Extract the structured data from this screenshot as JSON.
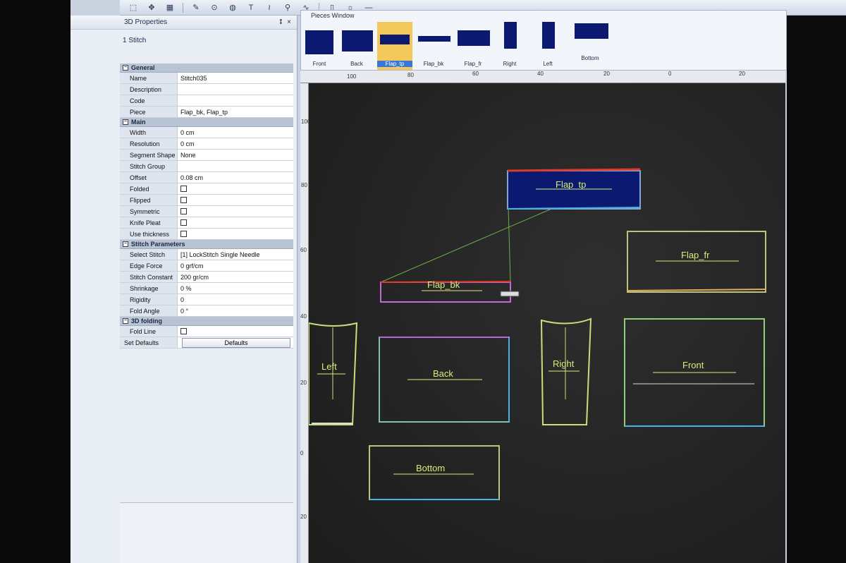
{
  "toolbar": {
    "icons": [
      "select-icon",
      "move-icon",
      "grid-icon",
      "pen-icon",
      "point-icon",
      "globe-icon",
      "text-icon",
      "stitch-icon",
      "needle-icon",
      "curve-icon"
    ],
    "text_glyph": "T"
  },
  "properties_panel": {
    "title": "3D Properties",
    "pin_glyph": "⭥",
    "close_glyph": "×",
    "selection": "1 Stitch",
    "categories": [
      {
        "name": "General",
        "rows": [
          {
            "key": "Name",
            "value": "Stitch035"
          },
          {
            "key": "Description",
            "value": ""
          },
          {
            "key": "Code",
            "value": ""
          },
          {
            "key": "Piece",
            "value": "Flap_bk, Flap_tp"
          }
        ]
      },
      {
        "name": "Main",
        "rows": [
          {
            "key": "Width",
            "value": "0 cm"
          },
          {
            "key": "Resolution",
            "value": "0 cm"
          },
          {
            "key": "Segment Shape",
            "value": "None"
          },
          {
            "key": "Stitch Group",
            "value": ""
          },
          {
            "key": "Offset",
            "value": "0.08 cm"
          },
          {
            "key": "Folded",
            "checkbox": true
          },
          {
            "key": "Flipped",
            "checkbox": true
          },
          {
            "key": "Symmetric",
            "checkbox": true
          },
          {
            "key": "Knife Pleat",
            "checkbox": true
          },
          {
            "key": "Use thickness",
            "checkbox": true
          }
        ]
      },
      {
        "name": "Stitch Parameters",
        "rows": [
          {
            "key": "Select Stitch",
            "value": "[1] LockStitch Single Needle"
          },
          {
            "key": "Edge Force",
            "value": "0 grf/cm"
          },
          {
            "key": "Stitch Constant",
            "value": "200 gr/cm"
          },
          {
            "key": "Shrinkage",
            "value": "0 %"
          },
          {
            "key": "Rigidity",
            "value": "0"
          },
          {
            "key": "Fold Angle",
            "value": "0 °"
          }
        ]
      },
      {
        "name": "3D folding",
        "rows": [
          {
            "key": "Fold Line",
            "checkbox": true
          }
        ]
      }
    ],
    "set_defaults_label": "Set Defaults",
    "defaults_button": "Defaults"
  },
  "pieces_window": {
    "title": "Pieces Window",
    "pieces": [
      "Front",
      "Back",
      "Flap_tp",
      "Flap_bk",
      "Flap_fr",
      "Right",
      "Left",
      "Bottom"
    ],
    "selected": "Flap_tp"
  },
  "ruler": {
    "top_ticks": [
      "100",
      "80",
      "60",
      "40",
      "20",
      "0",
      "20"
    ],
    "left_ticks": [
      "100",
      "80",
      "60",
      "40",
      "20",
      "0",
      "20"
    ]
  },
  "canvas": {
    "pieces": [
      "Flap_tp",
      "Flap_fr",
      "Flap_bk",
      "Left",
      "Back",
      "Right",
      "Front",
      "Bottom"
    ]
  },
  "colors": {
    "canvas_bg": "#262626",
    "piece_fill_selected": "#0b1970",
    "label_color": "#d9ee7a",
    "stitch_red": "#e03a2a",
    "stitch_green": "#7ed36a"
  }
}
